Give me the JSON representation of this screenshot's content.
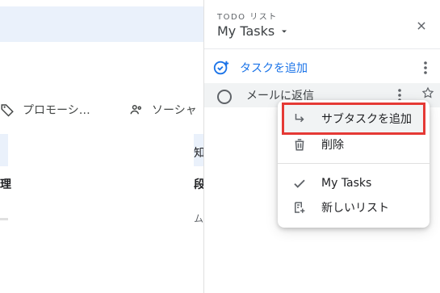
{
  "background": {
    "tabs": [
      {
        "label": "プロモーシ…"
      },
      {
        "label": "ソーシャ"
      }
    ],
    "snippets": {
      "col_right_top": "知",
      "left_bold": "理",
      "right_bold": "段",
      "right_small": "ム"
    }
  },
  "panel": {
    "kicker": "TODO リスト",
    "title": "My Tasks",
    "add_task_label": "タスクを追加",
    "task_title": "メールに返信"
  },
  "menu": {
    "items": [
      {
        "label": "サブタスクを追加"
      },
      {
        "label": "削除"
      },
      {
        "label": "My Tasks"
      },
      {
        "label": "新しいリスト"
      }
    ]
  },
  "colors": {
    "accent_blue": "#1a73e8",
    "highlight_red": "#e53935"
  },
  "icons": {
    "close": "close-icon",
    "caret": "caret-down-icon",
    "more": "more-vert-icon",
    "star": "star-icon",
    "tag": "label-icon",
    "people": "people-icon",
    "add_task": "add-task-icon",
    "subtask": "subdirectory-arrow-icon",
    "trash": "trash-icon",
    "check": "check-icon",
    "new_list": "new-list-icon"
  }
}
